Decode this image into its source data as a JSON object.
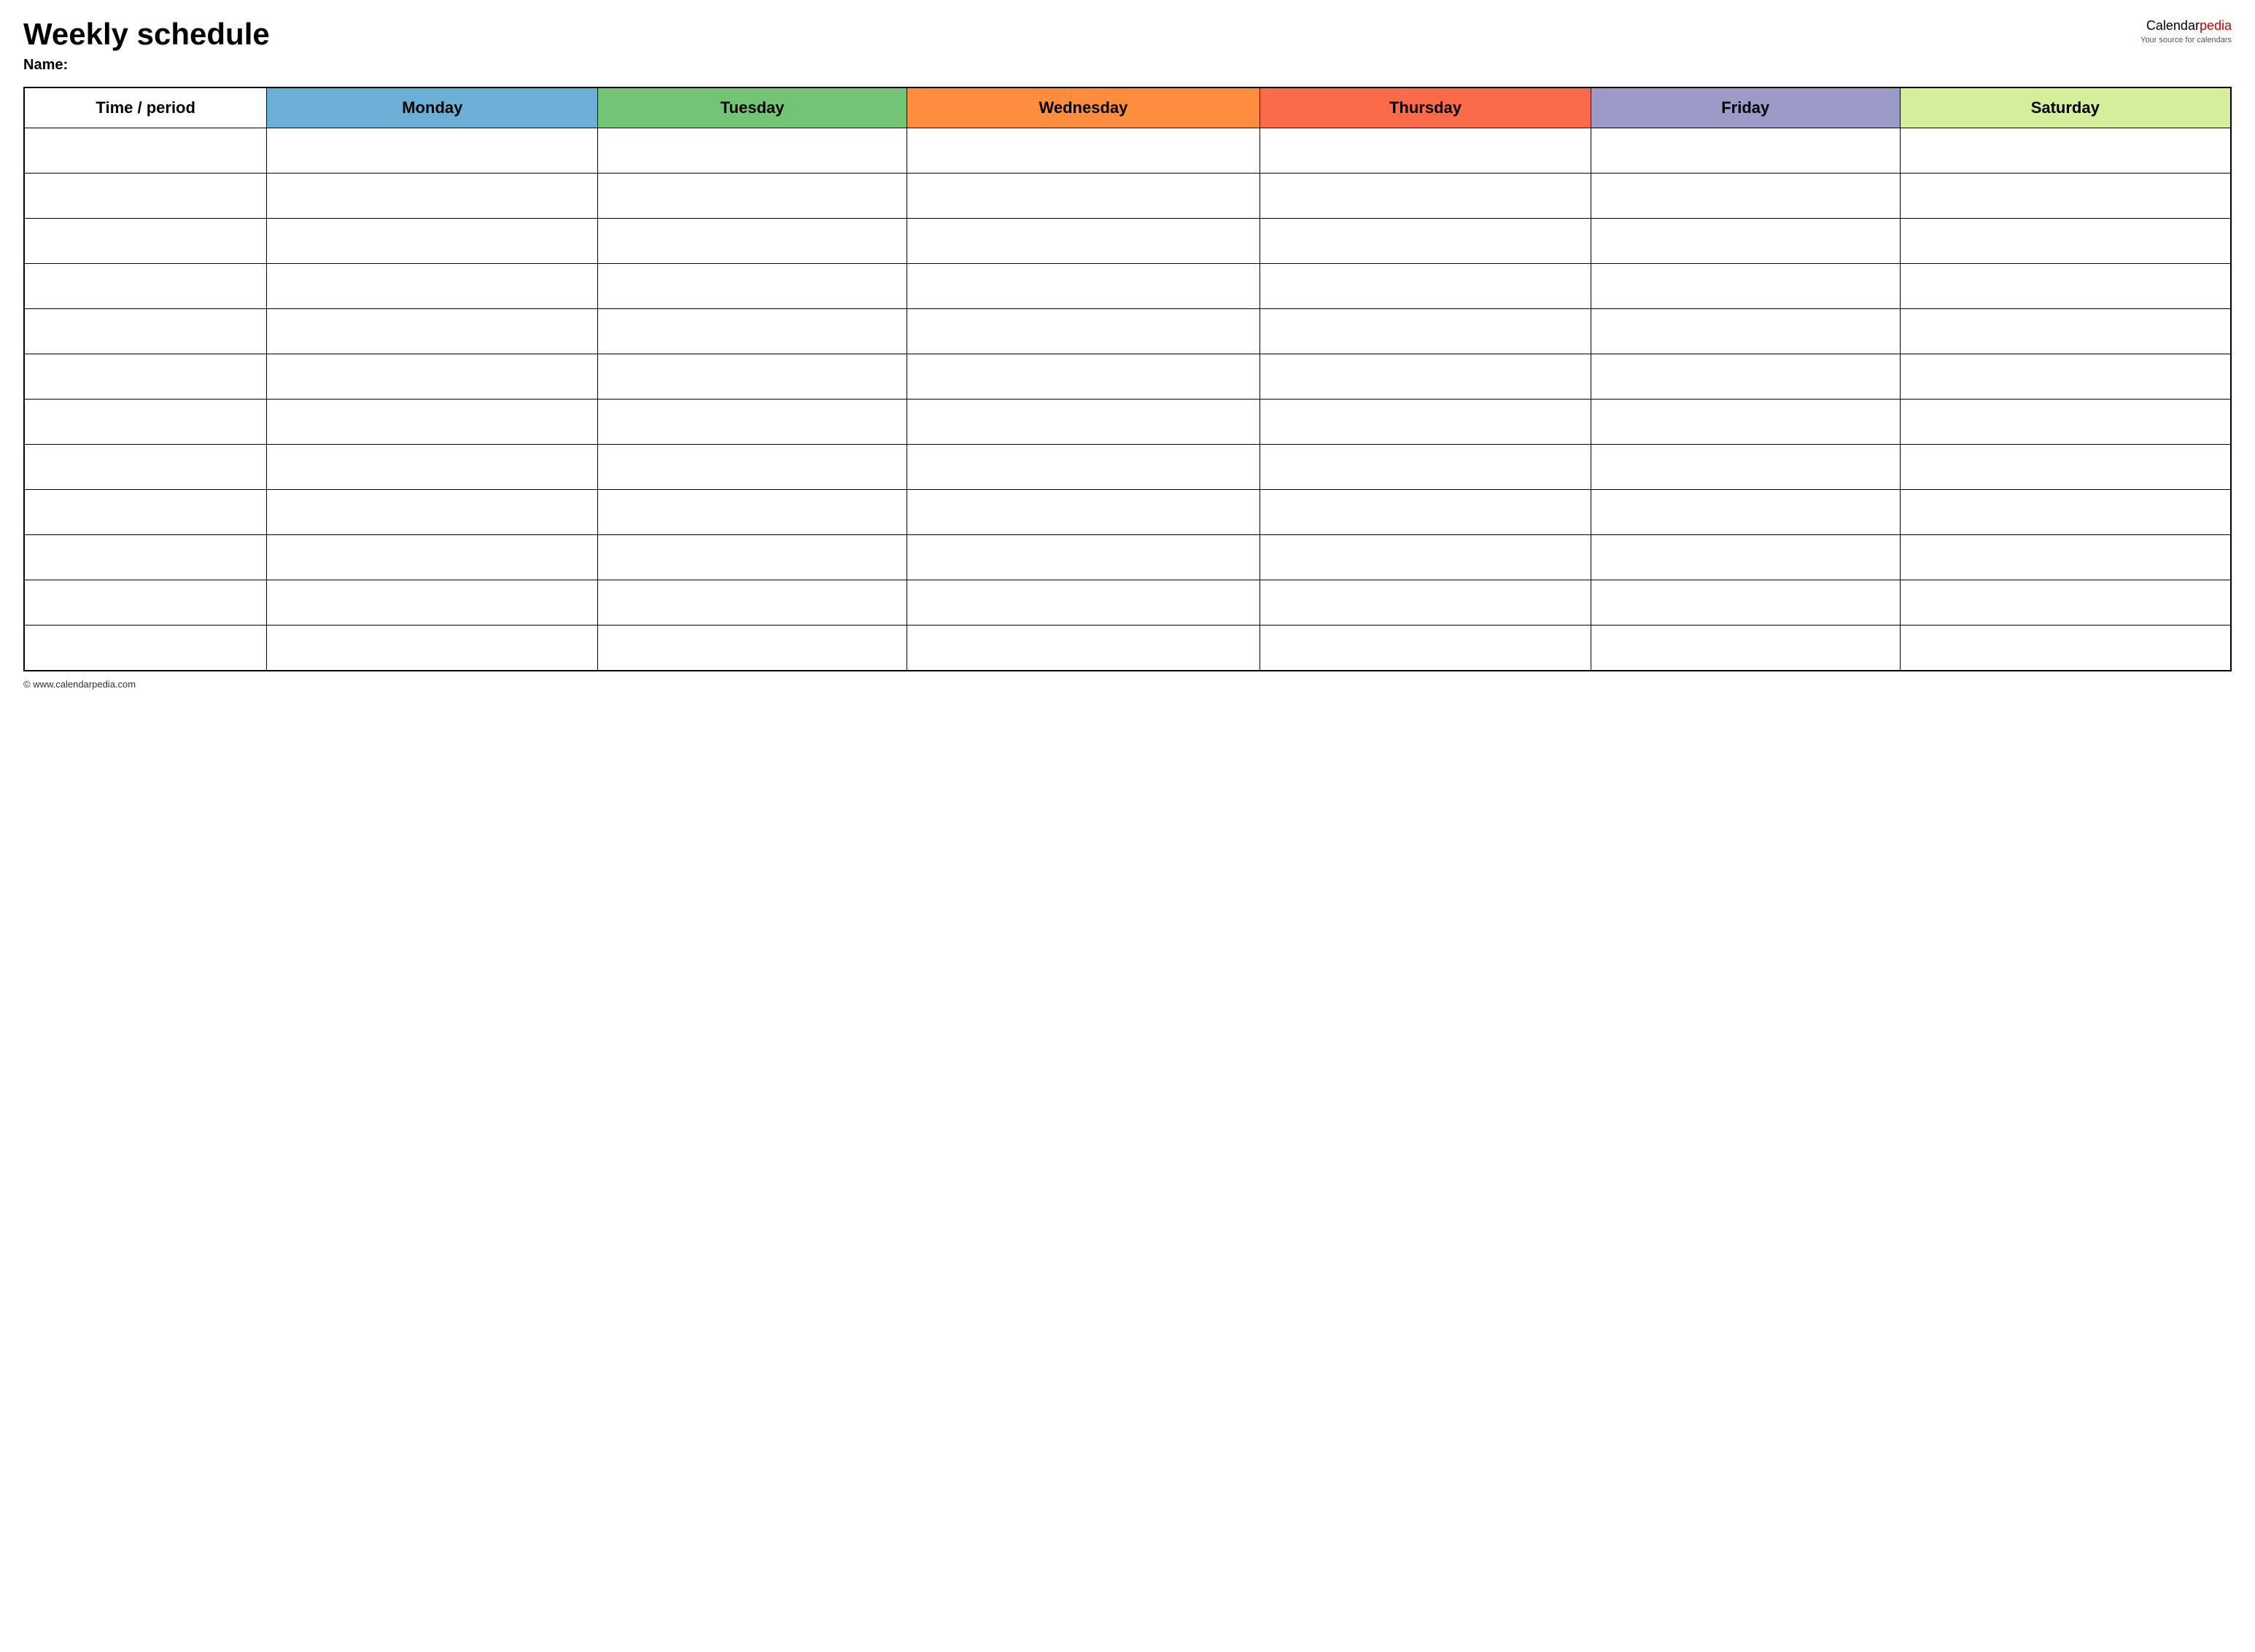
{
  "header": {
    "title": "Weekly schedule",
    "brand": {
      "name_prefix": "Calendar",
      "name_suffix": "pedia",
      "tagline": "Your source for calendars"
    }
  },
  "name_label": "Name:",
  "table": {
    "columns": [
      {
        "id": "time",
        "label": "Time / period",
        "class": "col-time"
      },
      {
        "id": "monday",
        "label": "Monday",
        "class": "col-monday"
      },
      {
        "id": "tuesday",
        "label": "Tuesday",
        "class": "col-tuesday"
      },
      {
        "id": "wednesday",
        "label": "Wednesday",
        "class": "col-wednesday"
      },
      {
        "id": "thursday",
        "label": "Thursday",
        "class": "col-thursday"
      },
      {
        "id": "friday",
        "label": "Friday",
        "class": "col-friday"
      },
      {
        "id": "saturday",
        "label": "Saturday",
        "class": "col-saturday"
      }
    ],
    "rows": 12
  },
  "footer": {
    "url": "© www.calendarpedia.com"
  }
}
